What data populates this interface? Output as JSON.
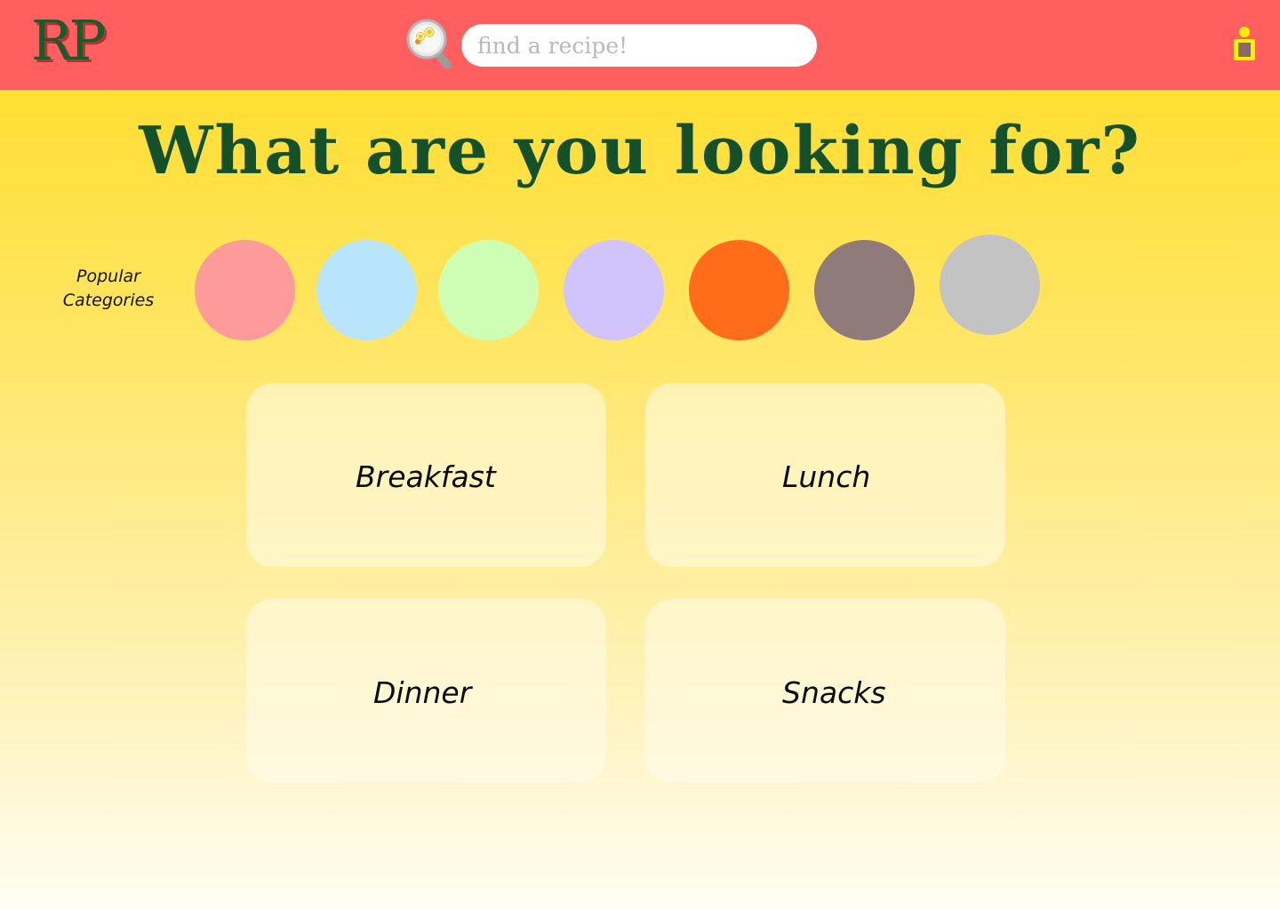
{
  "header": {
    "logo": "RP",
    "search": {
      "placeholder": "find a recipe!",
      "value": ""
    },
    "icons": {
      "search": "search-icon",
      "user": "user-icon"
    },
    "colors": {
      "background": "#ff5f5f",
      "logo": "#1b5a2a",
      "logo_shadow": "#b83131"
    }
  },
  "main": {
    "headline": "What are you looking for?",
    "popular": {
      "label": "Popular Categories",
      "circles": [
        {
          "color": "#fd9a9a"
        },
        {
          "color": "#b9e5fc"
        },
        {
          "color": "#cdfeb4"
        },
        {
          "color": "#d1c3fc"
        },
        {
          "color": "#ff6c1a"
        },
        {
          "color": "#8f7b79"
        },
        {
          "color": "#c3c3c3"
        }
      ]
    },
    "meals": [
      {
        "label": "Breakfast"
      },
      {
        "label": "Lunch"
      },
      {
        "label": "Dinner"
      },
      {
        "label": "Snacks"
      }
    ]
  },
  "theme": {
    "headline_color": "#14512a",
    "background_top": "#ffdc20",
    "background_bottom": "#fffdf5"
  }
}
